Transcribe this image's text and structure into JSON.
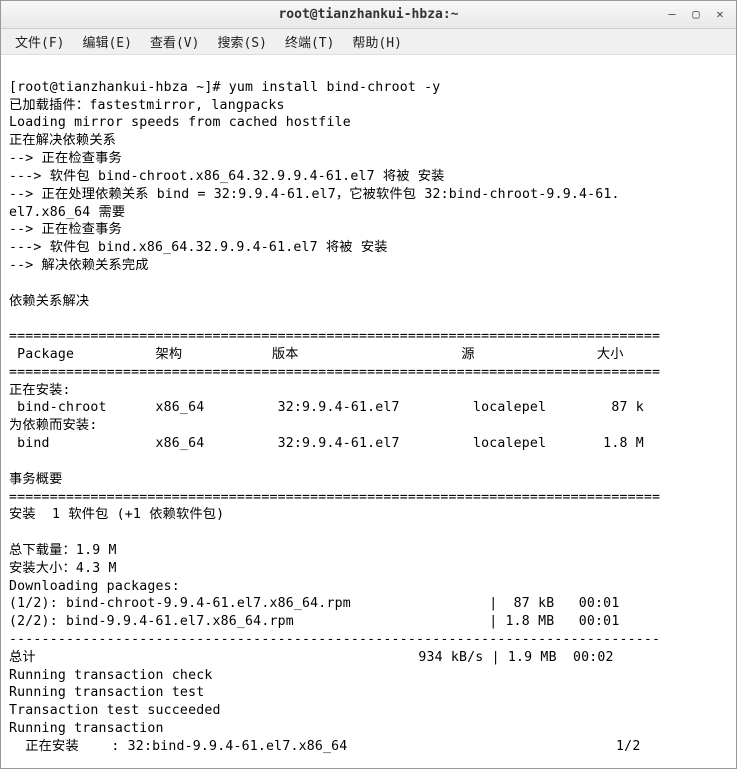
{
  "window": {
    "title": "root@tianzhankui-hbza:~"
  },
  "menubar": {
    "items": [
      "文件(F)",
      "编辑(E)",
      "查看(V)",
      "搜索(S)",
      "终端(T)",
      "帮助(H)"
    ]
  },
  "terminal": {
    "prompt": "[root@tianzhankui-hbza ~]# ",
    "command": "yum install bind-chroot -y",
    "lines": [
      "已加载插件：fastestmirror, langpacks",
      "Loading mirror speeds from cached hostfile",
      "正在解决依赖关系",
      "--> 正在检查事务",
      "---> 软件包 bind-chroot.x86_64.32.9.9.4-61.el7 将被 安装",
      "--> 正在处理依赖关系 bind = 32:9.9.4-61.el7，它被软件包 32:bind-chroot-9.9.4-61.",
      "el7.x86_64 需要",
      "--> 正在检查事务",
      "---> 软件包 bind.x86_64.32.9.9.4-61.el7 将被 安装",
      "--> 解决依赖关系完成",
      "",
      "依赖关系解决",
      ""
    ],
    "rule": "================================================================================",
    "table_header": " Package          架构           版本                    源               大小",
    "installing_header": "正在安装:",
    "pkg1": " bind-chroot      x86_64         32:9.9.4-61.el7         localepel        87 k",
    "dep_header": "为依赖而安装:",
    "pkg2": " bind             x86_64         32:9.9.4-61.el7         localepel       1.8 M",
    "summary_header": "事务概要",
    "install_summary": "安装  1 软件包 (+1 依赖软件包)",
    "totals": [
      "总下载量：1.9 M",
      "安装大小：4.3 M",
      "Downloading packages:"
    ],
    "dl1": "(1/2): bind-chroot-9.9.4-61.el7.x86_64.rpm                 |  87 kB   00:01",
    "dl2": "(2/2): bind-9.9.4-61.el7.x86_64.rpm                        | 1.8 MB   00:01",
    "dash_rule": "--------------------------------------------------------------------------------",
    "total_line": "总计                                               934 kB/s | 1.9 MB  00:02",
    "run_lines": [
      "Running transaction check",
      "Running transaction test",
      "Transaction test succeeded",
      "Running transaction"
    ],
    "installing_line": "  正在安装    : 32:bind-9.9.4-61.el7.x86_64                                 1/2"
  }
}
